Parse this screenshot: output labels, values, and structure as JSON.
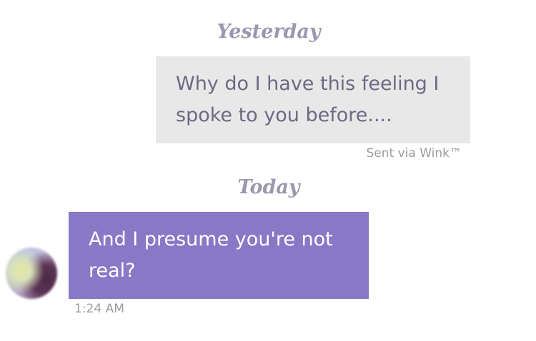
{
  "conversation": {
    "sections": [
      {
        "date_label": "Yesterday",
        "message": {
          "text": "Why do I have this feeling I spoke to you before....",
          "direction": "sent",
          "status": "Sent via Wink™"
        }
      },
      {
        "date_label": "Today",
        "message": {
          "text": "And I presume you're not real?",
          "direction": "received",
          "timestamp": "1:24 AM"
        }
      }
    ]
  },
  "colors": {
    "sent_bubble": "#e8e8e8",
    "sent_text": "#6c6a85",
    "received_bubble": "#8878c6",
    "received_text": "#ffffff",
    "date_header": "#9a97ae",
    "meta_text": "#9b9b9b"
  },
  "icons": {
    "avatar": "blurred-profile-avatar"
  }
}
